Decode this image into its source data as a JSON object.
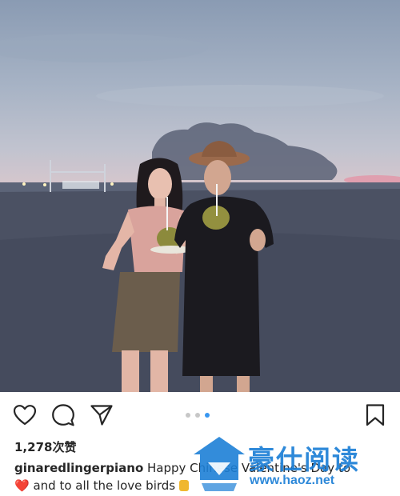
{
  "post": {
    "likes_text": "1,278次赞",
    "username": "ginaredlingerpiano",
    "caption_line1": " Happy Chinese Valentine's Day to",
    "caption_line2": " and to all the love birds ",
    "heart_emoji": "❤️",
    "carousel": {
      "count": 3,
      "active_index": 2
    }
  },
  "watermark": {
    "title": "豪仕阅读",
    "url": "www.haoz.net"
  },
  "colors": {
    "accent": "#3897f0",
    "watermark": "#1d7fd6",
    "text": "#262626"
  },
  "icons": {
    "like": "heart-outline-icon",
    "comment": "comment-bubble-icon",
    "share": "paper-plane-icon",
    "save": "bookmark-icon"
  }
}
